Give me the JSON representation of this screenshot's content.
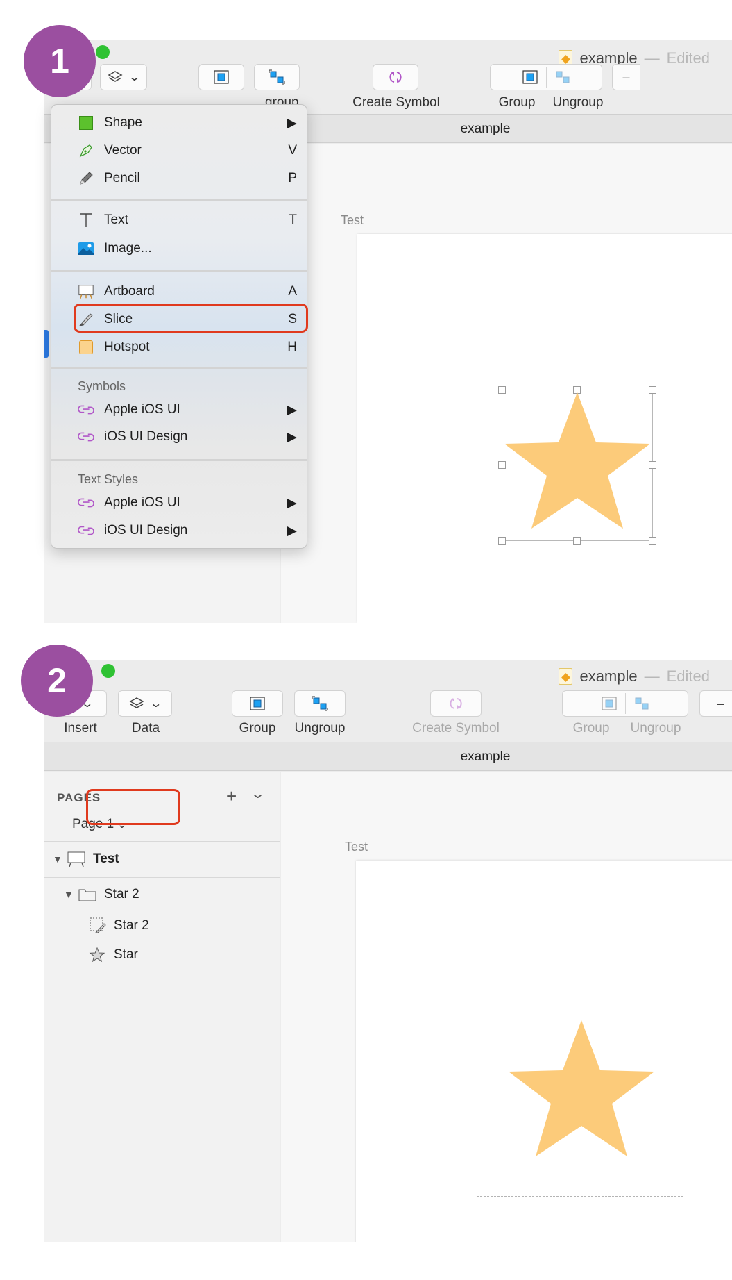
{
  "steps": {
    "first": "1",
    "second": "2"
  },
  "window": {
    "doc_name": "example",
    "dash": "—",
    "status": "Edited"
  },
  "toolbar1": {
    "labels": {
      "ungroup_partial": "group",
      "create_symbol": "Create Symbol",
      "group": "Group",
      "ungroup": "Ungroup"
    },
    "doc_header": "example"
  },
  "menu": {
    "items": [
      {
        "label": "Shape",
        "shortcut": "▶",
        "icon": "shape-icon"
      },
      {
        "label": "Vector",
        "shortcut": "V",
        "icon": "vector-pen-icon"
      },
      {
        "label": "Pencil",
        "shortcut": "P",
        "icon": "pencil-icon"
      },
      {
        "label": "Text",
        "shortcut": "T",
        "icon": "text-icon"
      },
      {
        "label": "Image...",
        "shortcut": "",
        "icon": "image-icon"
      },
      {
        "label": "Artboard",
        "shortcut": "A",
        "icon": "artboard-icon"
      },
      {
        "label": "Slice",
        "shortcut": "S",
        "icon": "slice-knife-icon"
      },
      {
        "label": "Hotspot",
        "shortcut": "H",
        "icon": "hotspot-icon"
      }
    ],
    "symbols_header": "Symbols",
    "symbols": [
      {
        "label": "Apple iOS UI",
        "shortcut": "▶",
        "icon": "symbol-link-icon"
      },
      {
        "label": "iOS UI Design",
        "shortcut": "▶",
        "icon": "symbol-link-icon"
      }
    ],
    "text_styles_header": "Text Styles",
    "text_styles": [
      {
        "label": "Apple iOS UI",
        "shortcut": "▶",
        "icon": "symbol-link-icon"
      },
      {
        "label": "iOS UI Design",
        "shortcut": "▶",
        "icon": "symbol-link-icon"
      }
    ]
  },
  "canvas1": {
    "artboard_label": "Test"
  },
  "toolbar2": {
    "labels": {
      "insert": "Insert",
      "data": "Data",
      "group": "Group",
      "ungroup": "Ungroup",
      "create_symbol": "Create Symbol",
      "group_disabled": "Group",
      "ungroup_disabled": "Ungroup"
    },
    "doc_header": "example"
  },
  "sidebar": {
    "pages_header": "PAGES",
    "current_page": "Page 1",
    "layers": [
      {
        "name": "Test",
        "icon": "artboard-icon"
      },
      {
        "name": "Star 2",
        "icon": "folder-icon"
      },
      {
        "name": "Star 2",
        "icon": "slice-layer-icon"
      },
      {
        "name": "Star",
        "icon": "star-outline-icon"
      }
    ]
  },
  "canvas2": {
    "artboard_label": "Test"
  },
  "colors": {
    "accent_purple": "#9b4fa0",
    "highlight_red": "#e03a1e",
    "star_fill": "#fccb7a",
    "traffic_green": "#2fc233"
  }
}
